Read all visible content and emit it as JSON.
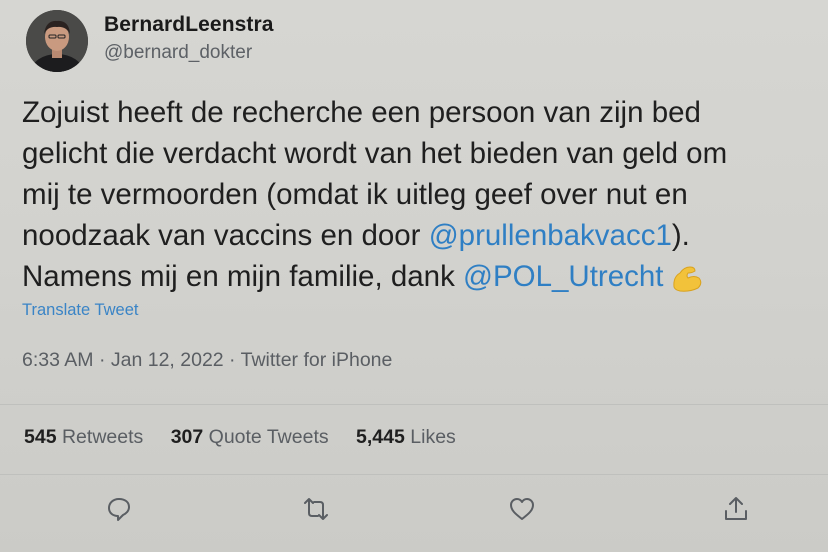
{
  "author": {
    "display_name": "BernardLeenstra",
    "handle": "@bernard_dokter",
    "avatar_icon": "profile-photo"
  },
  "tweet": {
    "lines": [
      {
        "text": "Zojuist heeft de recherche een persoon van zijn bed"
      },
      {
        "text": "gelicht die verdacht wordt van het bieden van geld om"
      },
      {
        "text": "mij te vermoorden (omdat ik uitleg geef over nut en"
      },
      {
        "text": "noodzaak van vaccins en door ",
        "mention": "@prullenbakvacc1",
        "after": ")."
      },
      {
        "text": "Namens mij en mijn familie, dank ",
        "mention": "@POL_Utrecht",
        "emoji": "flexed-biceps-icon"
      }
    ],
    "translate_label": "Translate Tweet",
    "timestamp": "6:33 AM · Jan 12, 2022 · Twitter for iPhone"
  },
  "stats": {
    "retweets": {
      "count": "545",
      "label": "Retweets"
    },
    "quote_tweets": {
      "count": "307",
      "label": "Quote Tweets"
    },
    "likes": {
      "count": "5,445",
      "label": "Likes"
    }
  },
  "actions": [
    "reply-icon",
    "retweet-icon",
    "like-icon",
    "share-icon"
  ],
  "colors": {
    "link": "#2f7fc4",
    "icon": "#5a5e63",
    "background": "#d3d3cf"
  }
}
